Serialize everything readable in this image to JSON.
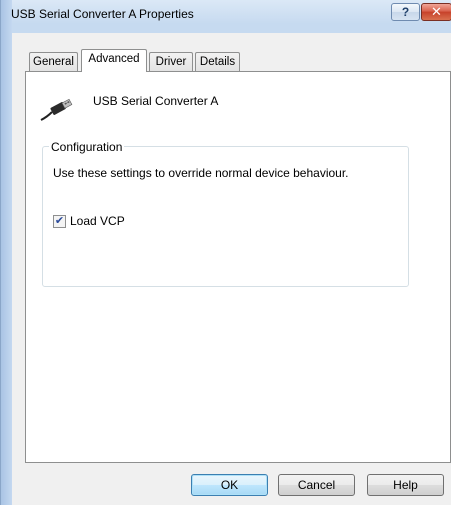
{
  "window": {
    "title": "USB Serial Converter A Properties",
    "help_button": "?",
    "close_button": "✕"
  },
  "tabs": [
    {
      "label": "General",
      "active": false
    },
    {
      "label": "Advanced",
      "active": true
    },
    {
      "label": "Driver",
      "active": false
    },
    {
      "label": "Details",
      "active": false
    }
  ],
  "device": {
    "icon": "usb-connector-icon",
    "name": "USB Serial Converter A"
  },
  "configuration": {
    "group_label": "Configuration",
    "description": "Use these settings to override normal device behaviour.",
    "load_vcp": {
      "label": "Load VCP",
      "checked": true
    }
  },
  "buttons": {
    "ok": "OK",
    "cancel": "Cancel",
    "help": "Help"
  },
  "colors": {
    "title_bar": "#c6daf0",
    "close_button": "#c7412a",
    "default_button_border": "#3c7fb1"
  }
}
